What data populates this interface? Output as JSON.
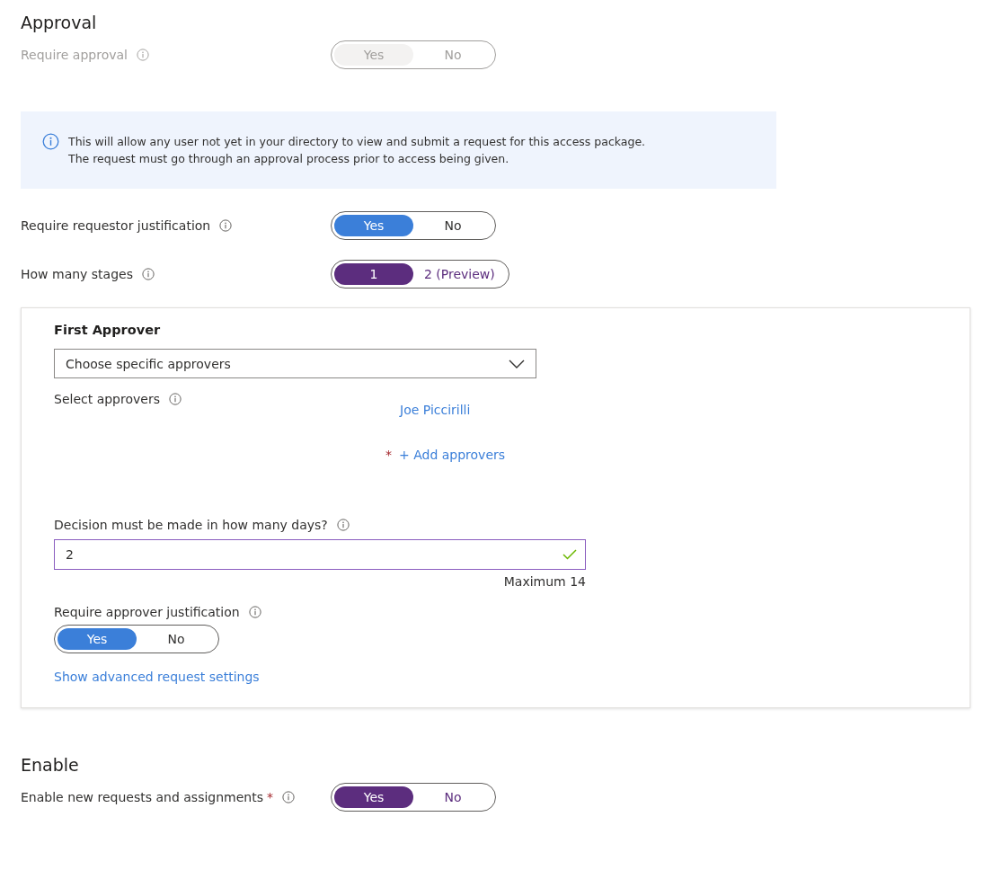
{
  "approval": {
    "heading": "Approval",
    "require_approval": {
      "label": "Require approval",
      "disabled": true,
      "options": [
        {
          "label": "Yes",
          "selected": true
        },
        {
          "label": "No",
          "selected": false
        }
      ]
    },
    "info_banner": {
      "lines": [
        "This will allow any user not yet in your directory to view and submit a request for this access package.",
        "The request must go through an approval process prior to access being given."
      ]
    },
    "requestor_justification": {
      "label": "Require requestor justification",
      "disabled": false,
      "color": "#3b7fd9",
      "options": [
        {
          "label": "Yes",
          "selected": true
        },
        {
          "label": "No",
          "selected": false
        }
      ]
    },
    "stages": {
      "label": "How many stages",
      "disabled": false,
      "color": "#5c2d7e",
      "options": [
        {
          "label": "1",
          "selected": true
        },
        {
          "label": "2 (Preview)",
          "selected": false
        }
      ]
    },
    "first_approver": {
      "title": "First Approver",
      "dropdown_value": "Choose specific approvers",
      "select_label": "Select approvers",
      "approvers": [
        "Joe Piccirilli"
      ],
      "add_link": "+ Add approvers",
      "required_mark": "*",
      "days_label": "Decision must be made in how many days?",
      "days_value": "2",
      "days_valid": true,
      "days_hint": "Maximum 14",
      "approver_justification": {
        "label": "Require approver justification",
        "disabled": false,
        "color": "#3b7fd9",
        "options": [
          {
            "label": "Yes",
            "selected": true
          },
          {
            "label": "No",
            "selected": false
          }
        ]
      },
      "advanced_link": "Show advanced request settings"
    }
  },
  "enable": {
    "heading": "Enable",
    "new_requests": {
      "label": "Enable new requests and assignments",
      "required_mark": "*",
      "disabled": false,
      "color": "#5c2d7e",
      "options": [
        {
          "label": "Yes",
          "selected": true
        },
        {
          "label": "No",
          "selected": false
        }
      ]
    }
  }
}
